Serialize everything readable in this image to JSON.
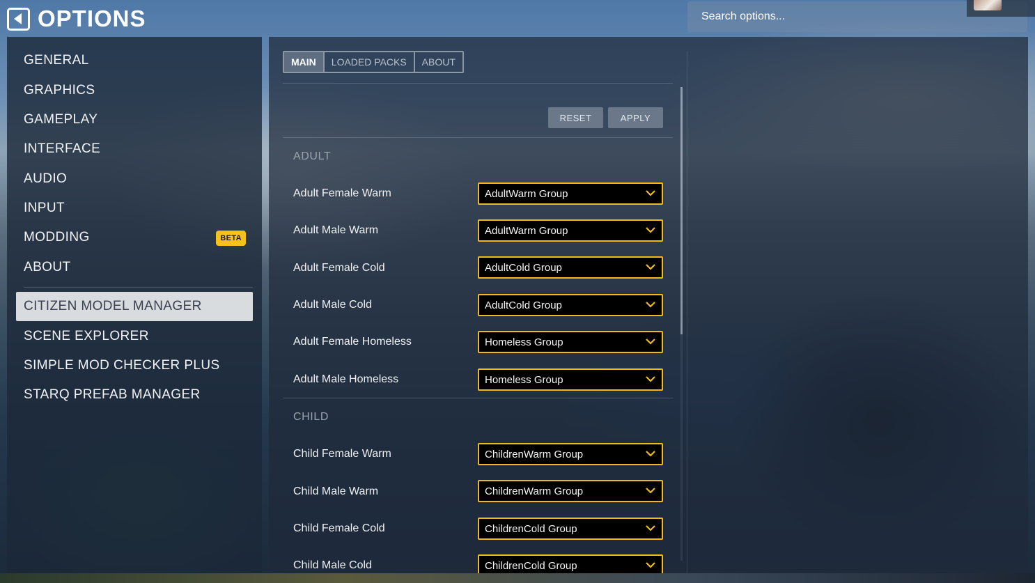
{
  "header": {
    "title": "OPTIONS",
    "search_placeholder": "Search options..."
  },
  "sidebar": {
    "items": [
      {
        "label": "GENERAL"
      },
      {
        "label": "GRAPHICS"
      },
      {
        "label": "GAMEPLAY"
      },
      {
        "label": "INTERFACE"
      },
      {
        "label": "AUDIO"
      },
      {
        "label": "INPUT"
      },
      {
        "label": "MODDING",
        "badge": "BETA"
      },
      {
        "label": "ABOUT"
      },
      {
        "label": "CITIZEN MODEL MANAGER",
        "active": true
      },
      {
        "label": "SCENE EXPLORER"
      },
      {
        "label": "SIMPLE MOD CHECKER PLUS"
      },
      {
        "label": "STARQ PREFAB MANAGER"
      }
    ]
  },
  "main": {
    "tabs": [
      {
        "label": "MAIN",
        "active": true
      },
      {
        "label": "LOADED PACKS"
      },
      {
        "label": "ABOUT"
      }
    ],
    "buttons": {
      "reset": "RESET",
      "apply": "APPLY"
    },
    "sections": [
      {
        "title": "ADULT",
        "rows": [
          {
            "label": "Adult Female Warm",
            "value": "AdultWarm Group"
          },
          {
            "label": "Adult Male Warm",
            "value": "AdultWarm Group"
          },
          {
            "label": "Adult Female Cold",
            "value": "AdultCold Group"
          },
          {
            "label": "Adult Male Cold",
            "value": "AdultCold Group"
          },
          {
            "label": "Adult Female Homeless",
            "value": "Homeless Group"
          },
          {
            "label": "Adult Male Homeless",
            "value": "Homeless Group"
          }
        ]
      },
      {
        "title": "CHILD",
        "rows": [
          {
            "label": "Child Female Warm",
            "value": "ChildrenWarm Group"
          },
          {
            "label": "Child Male Warm",
            "value": "ChildrenWarm Group"
          },
          {
            "label": "Child Female Cold",
            "value": "ChildrenCold Group"
          },
          {
            "label": "Child Male Cold",
            "value": "ChildrenCold Group"
          }
        ]
      }
    ]
  },
  "colors": {
    "accent_border": "#f0bb1a",
    "beta_badge": "#f4c21a",
    "active_nav_bg": "#d9dcdf"
  },
  "icons": {
    "back": "back-arrow-icon",
    "dropdown": "chevron-down-icon"
  }
}
